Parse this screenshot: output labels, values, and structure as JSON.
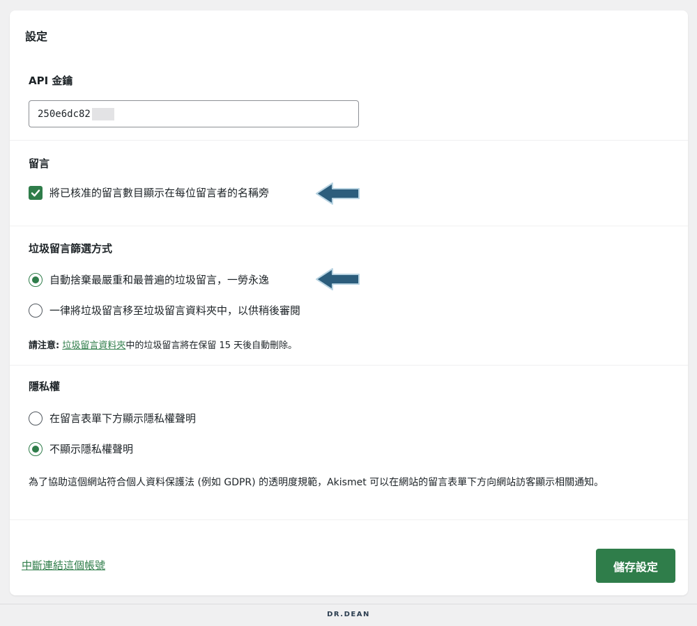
{
  "settings": {
    "title": "設定"
  },
  "api_key": {
    "label": "API 金鑰",
    "value": "250e6dc82"
  },
  "comments": {
    "title": "留言",
    "show_count_label": "將已核准的留言數目顯示在每位留言者的名稱旁",
    "show_count_checked": true
  },
  "spam": {
    "title": "垃圾留言篩選方式",
    "option_discard": "自動捨棄最嚴重和最普遍的垃圾留言，一勞永逸",
    "option_folder": "一律將垃圾留言移至垃圾留言資料夾中，以供稍後審閱",
    "selected": "discard",
    "note_prefix": "請注意:",
    "note_link": "垃圾留言資料夾",
    "note_suffix": "中的垃圾留言將在保留 15 天後自動刪除。"
  },
  "privacy": {
    "title": "隱私權",
    "option_show": "在留言表單下方顯示隱私權聲明",
    "option_hide": "不顯示隱私權聲明",
    "selected": "hide",
    "note": "為了協助這個網站符合個人資料保護法 (例如 GDPR) 的透明度規範，Akismet 可以在網站的留言表單下方向網站訪客顯示相關通知。"
  },
  "actions": {
    "disconnect_label": "中斷連結這個帳號",
    "save_label": "儲存設定"
  },
  "watermark": {
    "text": "DR.DEAN"
  },
  "colors": {
    "accent": "#2f7d4a",
    "arrow": "#2c5d7c",
    "background": "#f0f0f1"
  }
}
